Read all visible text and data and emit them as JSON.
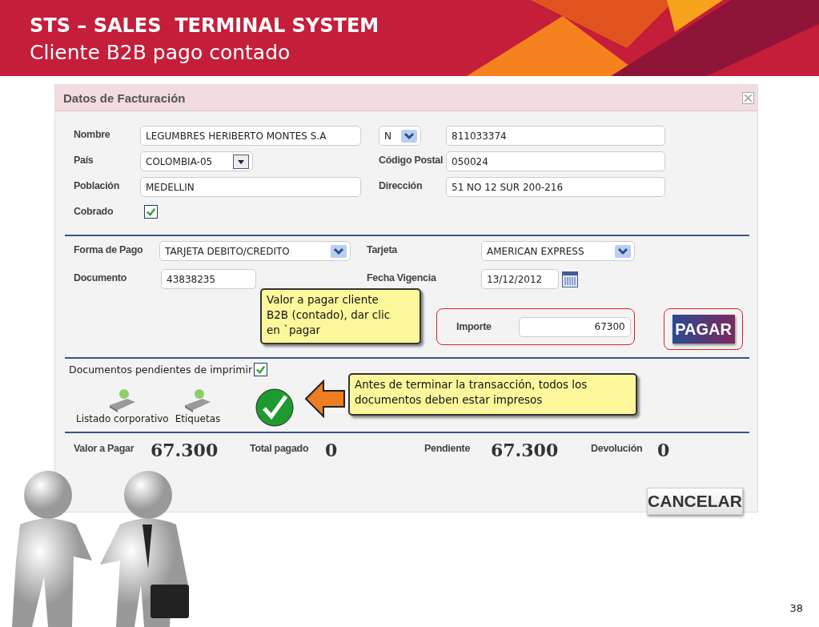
{
  "slide": {
    "title": "STS – SALES  TERMINAL SYSTEM",
    "subtitle": "Cliente B2B pago contado",
    "page_number": "38"
  },
  "dialog": {
    "title": "Datos de Facturación",
    "customer": {
      "nombre": {
        "label": "Nombre",
        "value": "LEGUMBRES HERIBERTO MONTES S.A"
      },
      "id_type": {
        "value": "N"
      },
      "id_number": {
        "value": "811033374"
      },
      "pais": {
        "label": "País",
        "value": "COLOMBIA-05"
      },
      "codigo_postal": {
        "label": "Código Postal",
        "value": "050024"
      },
      "poblacion": {
        "label": "Población",
        "value": "MEDELLIN"
      },
      "direccion": {
        "label": "Dirección",
        "value": "51 NO 12 SUR 200-216"
      },
      "cobrado": {
        "label": "Cobrado",
        "checked": true
      }
    },
    "payment": {
      "forma_pago": {
        "label": "Forma de Pago",
        "value": "TARJETA DEBITO/CREDITO"
      },
      "tarjeta": {
        "label": "Tarjeta",
        "value": "AMERICAN EXPRESS"
      },
      "documento": {
        "label": "Documento",
        "value": "43838235"
      },
      "fecha_vigencia": {
        "label": "Fecha Vigencia",
        "value": "13/12/2012"
      },
      "importe": {
        "label": "Importe",
        "value": "67300"
      },
      "pay_button": "PAGAR"
    },
    "printing": {
      "label": "Documentos pendientes de imprimir",
      "checked": true,
      "documents": [
        {
          "label": "Listado corporativo"
        },
        {
          "label": "Etiquetas"
        }
      ]
    },
    "totals": [
      {
        "label": "Valor a Pagar",
        "value": "67.300"
      },
      {
        "label": "Total pagado",
        "value": "0"
      },
      {
        "label": "Pendiente",
        "value": "67.300"
      },
      {
        "label": "Devolución",
        "value": "0"
      }
    ],
    "cancel_button": "CANCELAR"
  },
  "callouts": [
    {
      "text": "Valor a pagar cliente B2B  (contado), dar clic en `pagar"
    },
    {
      "text": "Antes de terminar la transacción, todos los documentos deben estar impresos"
    }
  ]
}
